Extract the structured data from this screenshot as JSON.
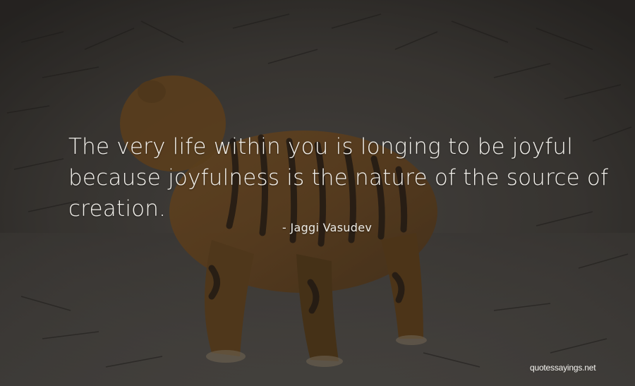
{
  "quote": {
    "lines": [
      "The very life within you is longing to be joyful",
      "because joyfulness is the nature of the source of",
      "creation."
    ],
    "author": "- Jaggi Vasudev"
  },
  "watermark": "quotessayings.net",
  "colors": {
    "overlay": "#3b3936",
    "snow_tint": "#55534f",
    "tiger_orange": "#8a5a22",
    "tiger_stripe": "#221a12",
    "text": "#f3f1ec"
  }
}
